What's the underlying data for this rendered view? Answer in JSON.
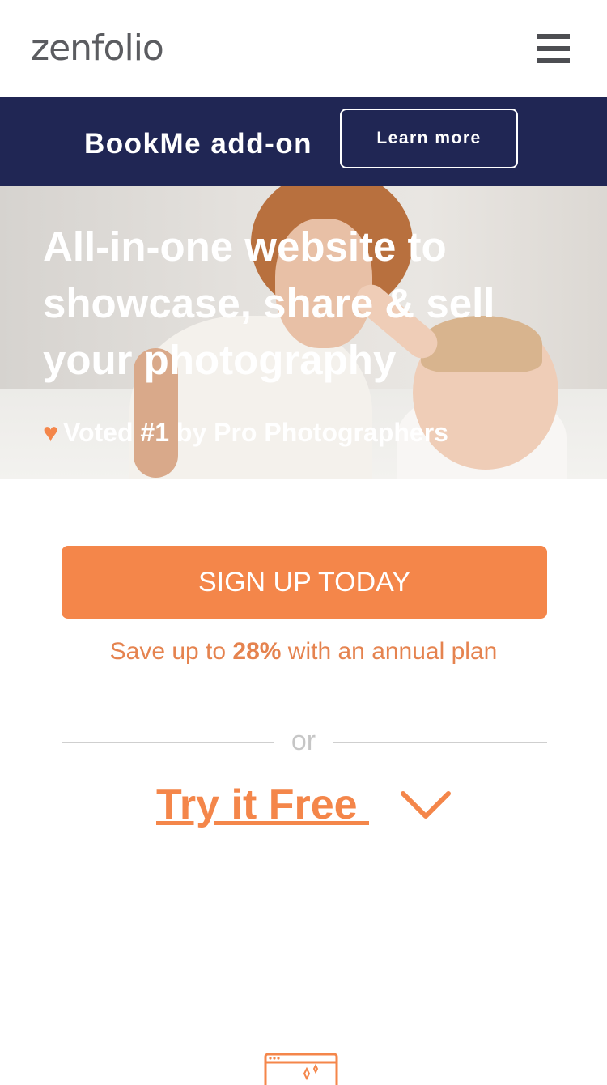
{
  "header": {
    "logo": "zenfolio",
    "menu_icon": "hamburger-menu-icon"
  },
  "promo": {
    "text": "BookMe add-on",
    "button_label": "Learn more",
    "background": "#202654"
  },
  "hero": {
    "title": "All-in-one website to showcase, share & sell your photography",
    "voted_icon": "heart-icon",
    "voted_text": "Voted #1 by Pro Photographers"
  },
  "cta": {
    "signup_label": "SIGN UP TODAY",
    "save_prefix": "Save up to ",
    "save_percent": "28%",
    "save_suffix": " with an annual plan",
    "or_text": "or",
    "try_free_label": "Try it Free ",
    "chevron_icon": "chevron-down-icon"
  },
  "colors": {
    "accent": "#f4864a",
    "nav_dark": "#202654"
  },
  "bottom": {
    "icon": "browser-window-icon"
  }
}
